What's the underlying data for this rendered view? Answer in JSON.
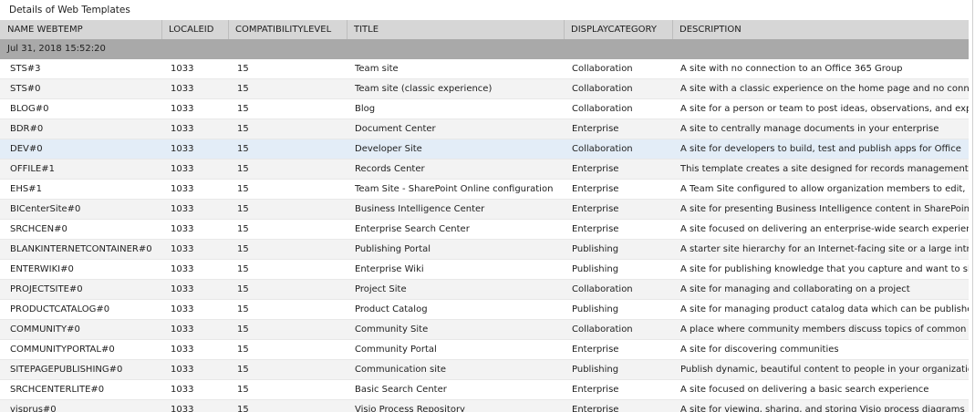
{
  "window": {
    "title": "Details of Web Templates"
  },
  "columns": [
    "NAME WEBTEMP",
    "LOCALEID",
    "COMPATIBILITYLEVEL",
    "TITLE",
    "DISPLAYCATEGORY",
    "DESCRIPTION"
  ],
  "group": {
    "label": "Jul 31, 2018 15:52:20"
  },
  "rows": [
    [
      "STS#3",
      "1033",
      "15",
      "Team site",
      "Collaboration",
      "A site with no connection to an Office 365 Group"
    ],
    [
      "STS#0",
      "1033",
      "15",
      "Team site (classic experience)",
      "Collaboration",
      "A site with a classic experience on the home page and no connect"
    ],
    [
      "BLOG#0",
      "1033",
      "15",
      "Blog",
      "Collaboration",
      "A site for a person or team to post ideas, observations, and exper"
    ],
    [
      "BDR#0",
      "1033",
      "15",
      "Document Center",
      "Enterprise",
      "A site to centrally manage documents in your enterprise"
    ],
    [
      "DEV#0",
      "1033",
      "15",
      "Developer Site",
      "Collaboration",
      "A site for developers to build, test and publish apps for Office"
    ],
    [
      "OFFILE#1",
      "1033",
      "15",
      "Records Center",
      "Enterprise",
      "This template creates a site designed for records management"
    ],
    [
      "EHS#1",
      "1033",
      "15",
      "Team Site - SharePoint Online configuration",
      "Enterprise",
      "A Team Site configured to allow organization members to edit, cre"
    ],
    [
      "BICenterSite#0",
      "1033",
      "15",
      "Business Intelligence Center",
      "Enterprise",
      "A site for presenting Business Intelligence content in SharePoint"
    ],
    [
      "SRCHCEN#0",
      "1033",
      "15",
      "Enterprise Search Center",
      "Enterprise",
      "A site focused on delivering an enterprise-wide search experience"
    ],
    [
      "BLANKINTERNETCONTAINER#0",
      "1033",
      "15",
      "Publishing Portal",
      "Publishing",
      "A starter site hierarchy for an Internet-facing site or a large intran"
    ],
    [
      "ENTERWIKI#0",
      "1033",
      "15",
      "Enterprise Wiki",
      "Publishing",
      "A site for publishing knowledge that you capture and want to shar"
    ],
    [
      "PROJECTSITE#0",
      "1033",
      "15",
      "Project Site",
      "Collaboration",
      "A site for managing and collaborating on a project"
    ],
    [
      "PRODUCTCATALOG#0",
      "1033",
      "15",
      "Product Catalog",
      "Publishing",
      "A site for managing product catalog data which can be published"
    ],
    [
      "COMMUNITY#0",
      "1033",
      "15",
      "Community Site",
      "Collaboration",
      "A place where community members discuss topics of common int"
    ],
    [
      "COMMUNITYPORTAL#0",
      "1033",
      "15",
      "Community Portal",
      "Enterprise",
      "A site for discovering communities"
    ],
    [
      "SITEPAGEPUBLISHING#0",
      "1033",
      "15",
      "Communication site",
      "Publishing",
      "Publish dynamic, beautiful content to people in your organization"
    ],
    [
      "SRCHCENTERLITE#0",
      "1033",
      "15",
      "Basic Search Center",
      "Enterprise",
      "A site focused on delivering a basic search experience"
    ],
    [
      "visprus#0",
      "1033",
      "15",
      "Visio Process Repository",
      "Enterprise",
      "A site for viewing, sharing, and storing Visio process diagrams"
    ]
  ],
  "selected_row": 4
}
